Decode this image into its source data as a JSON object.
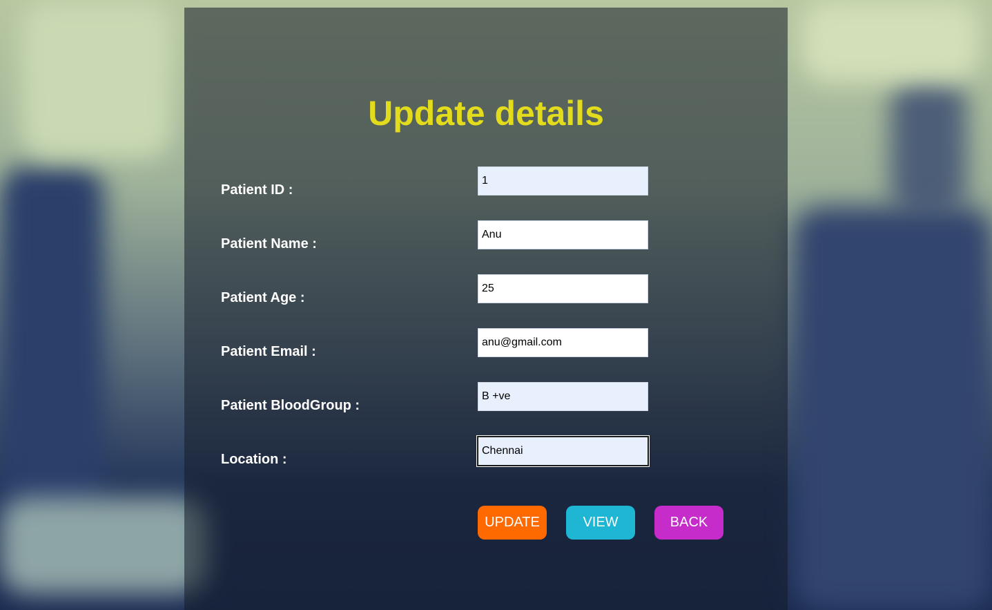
{
  "page": {
    "title": "Update details"
  },
  "form": {
    "fields": [
      {
        "label": "Patient ID :",
        "value": "1"
      },
      {
        "label": "Patient Name :",
        "value": "Anu"
      },
      {
        "label": "Patient Age :",
        "value": "25"
      },
      {
        "label": "Patient Email :",
        "value": "anu@gmail.com"
      },
      {
        "label": "Patient BloodGroup :",
        "value": "B +ve"
      },
      {
        "label": "Location :",
        "value": "Chennai"
      }
    ]
  },
  "buttons": {
    "update": {
      "label": "UPDATE",
      "color": "#ff6a00"
    },
    "view": {
      "label": "VIEW",
      "color": "#1fb6d3"
    },
    "back": {
      "label": "BACK",
      "color": "#c52cc9"
    }
  },
  "colors": {
    "title": "#e3dc1c",
    "label": "#ffffff",
    "autofill_bg": "#e8f0fe"
  }
}
